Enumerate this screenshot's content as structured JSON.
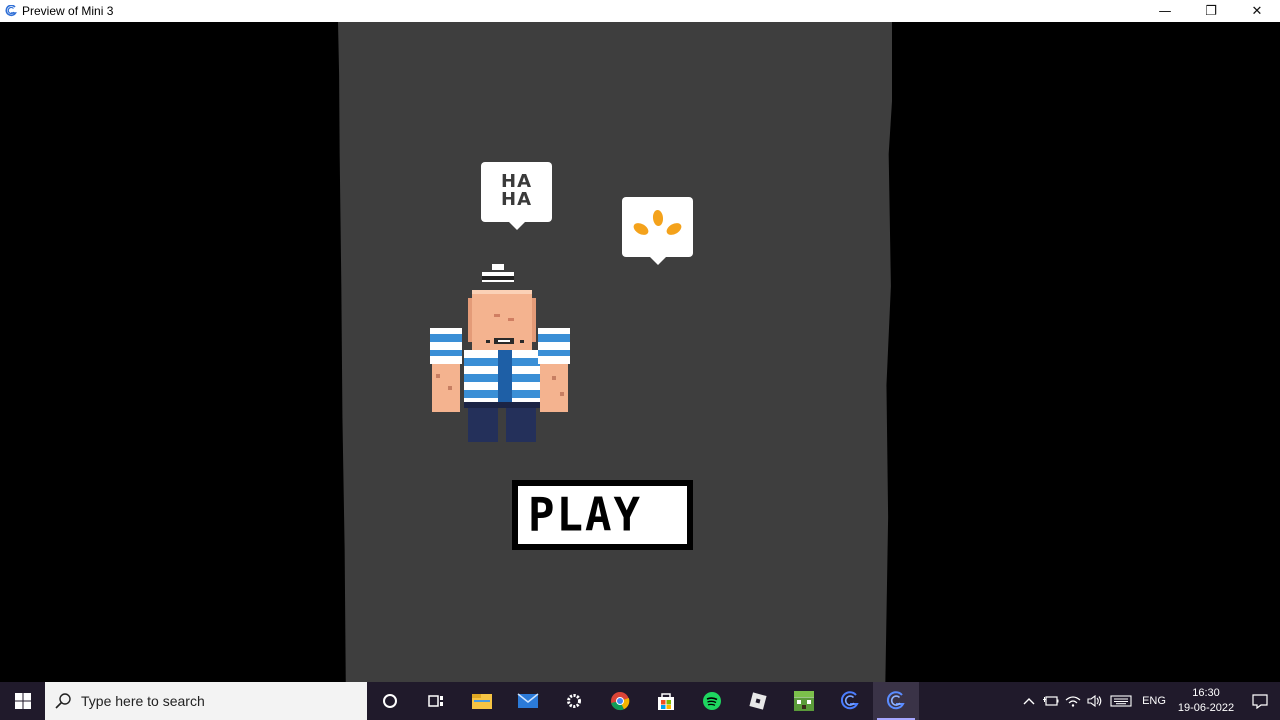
{
  "window": {
    "title": "Preview of Mini 3",
    "minimize_glyph": "—",
    "restore_glyph": "❐",
    "close_glyph": "✕"
  },
  "game": {
    "bubble_haha_line1": "HA",
    "bubble_haha_line2": "HA",
    "play_label": "PLAY",
    "colors": {
      "canvas_bg": "#3e3e3e",
      "sweat_drop": "#f4a21b",
      "stripe_blue": "#3a8fd6",
      "skin": "#f4b38f"
    }
  },
  "taskbar": {
    "search_placeholder": "Type here to search",
    "apps": [
      "cortana-icon",
      "task-view-icon",
      "file-explorer-icon",
      "mail-icon",
      "settings-icon",
      "chrome-icon",
      "store-icon",
      "spotify-icon",
      "roblox-icon",
      "minecraft-icon",
      "gdevelop-icon",
      "gdevelop-preview-icon"
    ],
    "language": "ENG",
    "time": "16:30",
    "date": "19-06-2022"
  }
}
